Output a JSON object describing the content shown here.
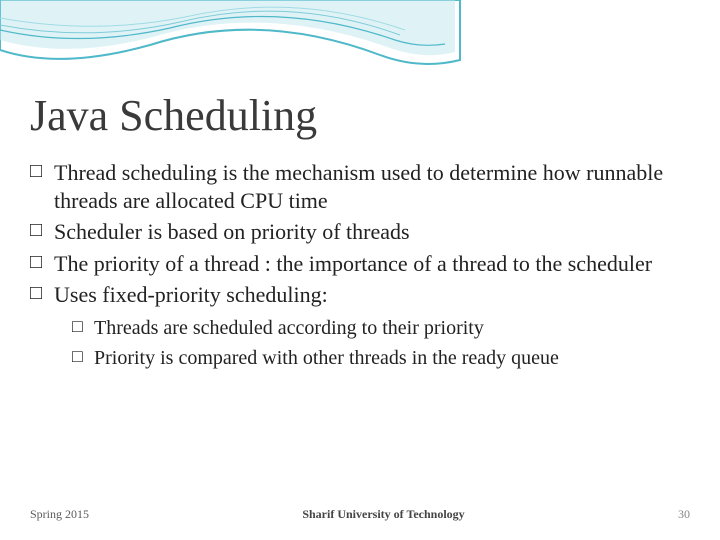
{
  "title": "Java Scheduling",
  "bullets": [
    {
      "text": "Thread scheduling is the mechanism used to determine how runnable threads are allocated CPU time"
    },
    {
      "text": "Scheduler is based on priority of threads"
    },
    {
      "text": "The priority of a thread : the importance of a thread to the scheduler"
    },
    {
      "text": "Uses fixed-priority scheduling:"
    }
  ],
  "sub_bullets": [
    {
      "text": "Threads are scheduled according to their priority"
    },
    {
      "text": "Priority is compared with other threads in the ready queue"
    }
  ],
  "footer": {
    "left": "Spring 2015",
    "center": "Sharif University of Technology",
    "right": "30"
  }
}
